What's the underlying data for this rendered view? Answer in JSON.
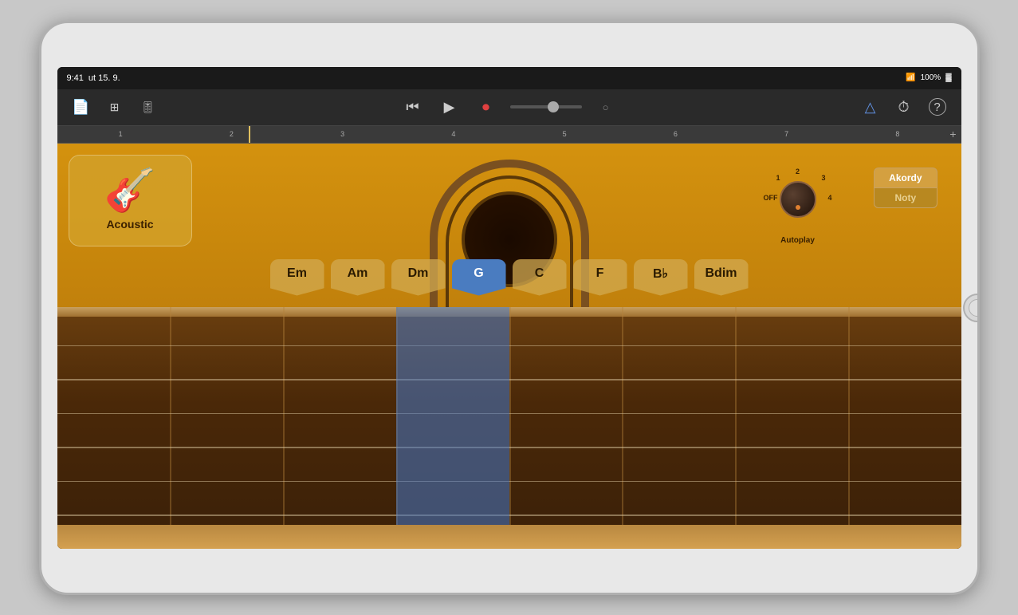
{
  "status_bar": {
    "time": "9:41",
    "date": "ut 15. 9.",
    "wifi": "●",
    "battery": "100%",
    "battery_icon": "🔋"
  },
  "toolbar": {
    "new_song_label": "📄",
    "tracks_label": "⊞",
    "mixer_label": "⚙",
    "rewind_label": "⏮",
    "play_label": "▶",
    "record_label": "⏺",
    "loop_label": "○",
    "metronome_label": "△",
    "settings_label": "⏱",
    "help_label": "?",
    "add_label": "+"
  },
  "timeline": {
    "marks": [
      "1",
      "2",
      "3",
      "4",
      "5",
      "6",
      "7",
      "8"
    ]
  },
  "instrument": {
    "name": "Acoustic",
    "icon": "🎸"
  },
  "autoplay": {
    "label": "Autoplay",
    "positions": [
      "OFF",
      "1",
      "2",
      "3",
      "4"
    ]
  },
  "mode_toggle": {
    "chords_label": "Akordy",
    "notes_label": "Noty"
  },
  "chords": [
    {
      "label": "Em",
      "active": false
    },
    {
      "label": "Am",
      "active": false
    },
    {
      "label": "Dm",
      "active": false
    },
    {
      "label": "G",
      "active": true
    },
    {
      "label": "C",
      "active": false
    },
    {
      "label": "F",
      "active": false
    },
    {
      "label": "B♭",
      "active": false
    },
    {
      "label": "Bdim",
      "active": false
    }
  ],
  "fretboard": {
    "string_count": 6,
    "fret_count": 8
  }
}
